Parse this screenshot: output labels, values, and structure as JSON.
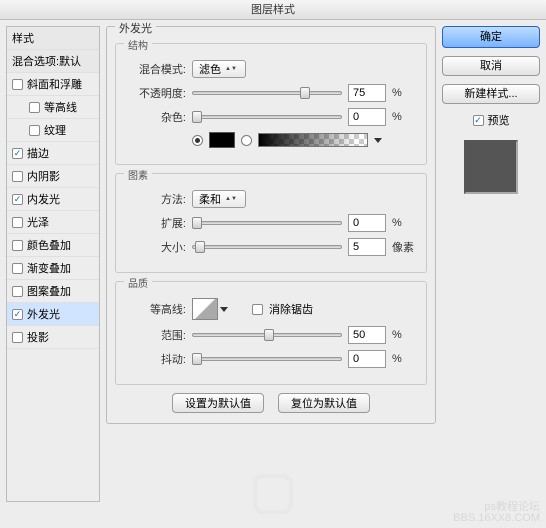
{
  "title": "图层样式",
  "sidebar": {
    "header1": "样式",
    "header2": "混合选项:默认",
    "items": [
      {
        "label": "斜面和浮雕",
        "checked": false
      },
      {
        "label": "等高线",
        "checked": false,
        "sub": true
      },
      {
        "label": "纹理",
        "checked": false,
        "sub": true
      },
      {
        "label": "描边",
        "checked": true
      },
      {
        "label": "内阴影",
        "checked": false
      },
      {
        "label": "内发光",
        "checked": true
      },
      {
        "label": "光泽",
        "checked": false
      },
      {
        "label": "颜色叠加",
        "checked": false
      },
      {
        "label": "渐变叠加",
        "checked": false
      },
      {
        "label": "图案叠加",
        "checked": false
      },
      {
        "label": "外发光",
        "checked": true,
        "selected": true
      },
      {
        "label": "投影",
        "checked": false
      }
    ]
  },
  "panel": {
    "title": "外发光",
    "structure": {
      "title": "结构",
      "blend_mode_label": "混合模式:",
      "blend_mode_value": "滤色",
      "opacity_label": "不透明度:",
      "opacity_value": "75",
      "opacity_unit": "%",
      "noise_label": "杂色:",
      "noise_value": "0",
      "noise_unit": "%"
    },
    "elements": {
      "title": "图素",
      "technique_label": "方法:",
      "technique_value": "柔和",
      "spread_label": "扩展:",
      "spread_value": "0",
      "spread_unit": "%",
      "size_label": "大小:",
      "size_value": "5",
      "size_unit": "像素"
    },
    "quality": {
      "title": "品质",
      "contour_label": "等高线:",
      "antialias_label": "消除锯齿",
      "range_label": "范围:",
      "range_value": "50",
      "range_unit": "%",
      "jitter_label": "抖动:",
      "jitter_value": "0",
      "jitter_unit": "%"
    },
    "set_default": "设置为默认值",
    "reset_default": "复位为默认值"
  },
  "right": {
    "ok": "确定",
    "cancel": "取消",
    "new_style": "新建样式...",
    "preview_label": "预览"
  },
  "watermark": {
    "line1": "ps教程论坛",
    "line2": "BBS.16XX8.COM"
  }
}
